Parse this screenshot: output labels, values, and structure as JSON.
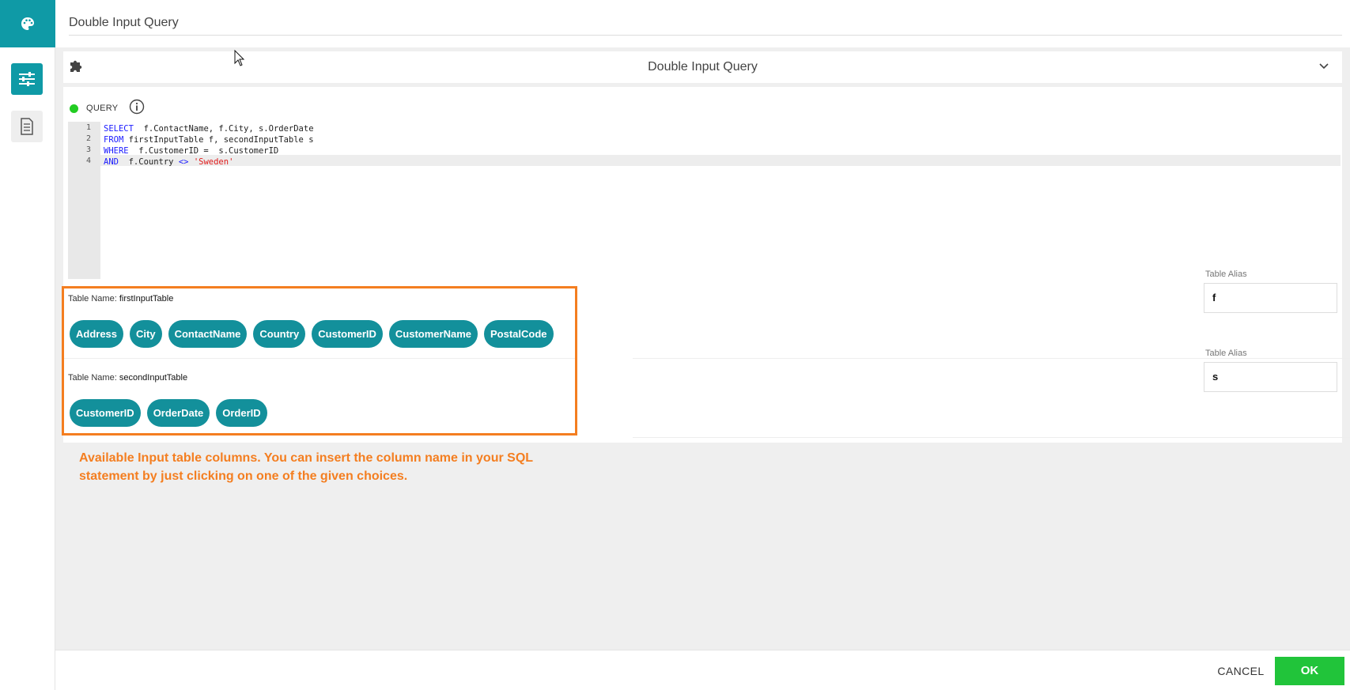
{
  "header": {
    "title": "Double Input Query"
  },
  "panel": {
    "title": "Double Input Query"
  },
  "query": {
    "label": "QUERY",
    "status_color": "#22cc22",
    "lines": [
      {
        "no": "1",
        "parts": [
          {
            "t": "SELECT",
            "c": "kw"
          },
          {
            "t": "  f.ContactName, f.City, s.OrderDate",
            "c": ""
          }
        ]
      },
      {
        "no": "2",
        "parts": [
          {
            "t": "FROM",
            "c": "kw"
          },
          {
            "t": " firstInputTable f, secondInputTable s",
            "c": ""
          }
        ]
      },
      {
        "no": "3",
        "parts": [
          {
            "t": "WHERE",
            "c": "kw"
          },
          {
            "t": "  f.CustomerID =  s.CustomerID",
            "c": ""
          }
        ]
      },
      {
        "no": "4",
        "parts": [
          {
            "t": "AND",
            "c": "kw"
          },
          {
            "t": "  f.Country ",
            "c": ""
          },
          {
            "t": "<>",
            "c": "kw"
          },
          {
            "t": " ",
            "c": ""
          },
          {
            "t": "'Sweden'",
            "c": "str"
          }
        ]
      }
    ]
  },
  "tables": [
    {
      "label_prefix": "Table Name:",
      "name": "firstInputTable",
      "columns": [
        "Address",
        "City",
        "ContactName",
        "Country",
        "CustomerID",
        "CustomerName",
        "PostalCode"
      ],
      "alias_label": "Table Alias",
      "alias_value": "f"
    },
    {
      "label_prefix": "Table Name:",
      "name": "secondInputTable",
      "columns": [
        "CustomerID",
        "OrderDate",
        "OrderID"
      ],
      "alias_label": "Table Alias",
      "alias_value": "s"
    }
  ],
  "annotation": "Available Input table columns. You can insert the column name in your SQL statement by just clicking on one of the given choices.",
  "footer": {
    "cancel_label": "CANCEL",
    "ok_label": "OK"
  },
  "colors": {
    "accent": "#0f9aa6",
    "chip": "#13909b",
    "ok": "#21c43a",
    "highlight": "#f47e20"
  }
}
